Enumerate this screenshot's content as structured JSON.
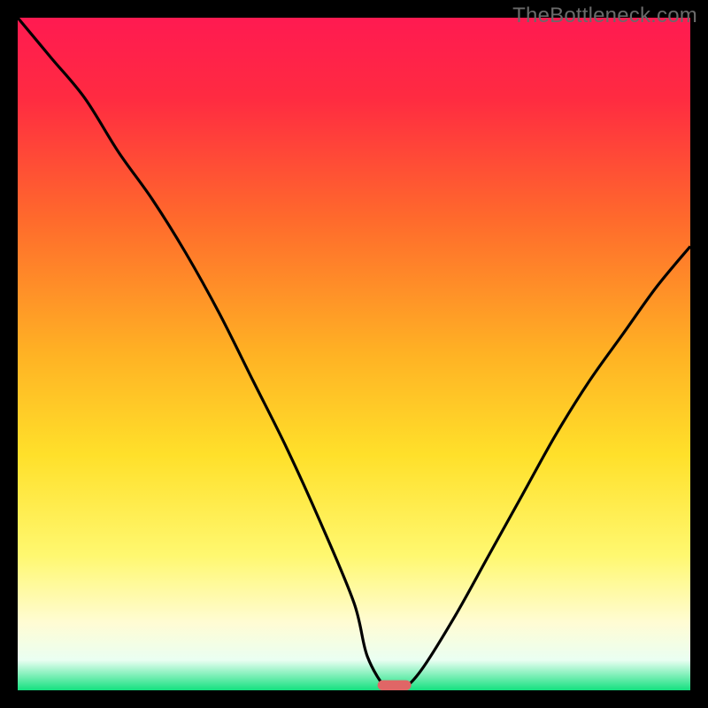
{
  "watermark": {
    "text": "TheBottleneck.com"
  },
  "chart_data": {
    "type": "line",
    "title": "",
    "xlabel": "",
    "ylabel": "",
    "xlim": [
      0,
      100
    ],
    "ylim": [
      0,
      100
    ],
    "series": [
      {
        "name": "bottleneck-curve",
        "x": [
          0,
          5,
          10,
          15,
          20,
          25,
          30,
          35,
          40,
          45,
          50,
          52,
          55,
          57,
          60,
          65,
          70,
          75,
          80,
          85,
          90,
          95,
          100
        ],
        "values": [
          100,
          94,
          88,
          80,
          73,
          65,
          56,
          46,
          36,
          25,
          13,
          5,
          0,
          0,
          3,
          11,
          20,
          29,
          38,
          46,
          53,
          60,
          66
        ]
      }
    ],
    "gradient_stops": [
      {
        "offset": 0.0,
        "color": "#ff1a51"
      },
      {
        "offset": 0.12,
        "color": "#ff2b41"
      },
      {
        "offset": 0.3,
        "color": "#ff6a2c"
      },
      {
        "offset": 0.5,
        "color": "#ffb224"
      },
      {
        "offset": 0.65,
        "color": "#ffe02a"
      },
      {
        "offset": 0.8,
        "color": "#fff870"
      },
      {
        "offset": 0.9,
        "color": "#fffcd4"
      },
      {
        "offset": 0.955,
        "color": "#eafff2"
      },
      {
        "offset": 1.0,
        "color": "#14e07f"
      }
    ],
    "marker": {
      "x": 56,
      "y": 0,
      "width_pct": 5,
      "height_pct": 1.5,
      "color": "#e06666"
    }
  },
  "colors": {
    "page_bg": "#000000",
    "curve_stroke": "#000000",
    "watermark": "#6a6a6a"
  }
}
